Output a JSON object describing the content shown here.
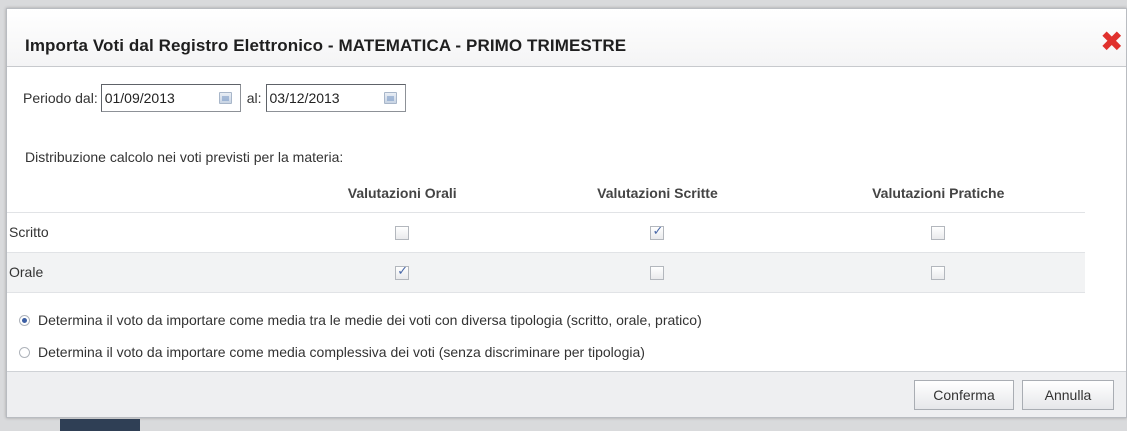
{
  "dialog": {
    "title": "Importa Voti dal Registro Elettronico - MATEMATICA - PRIMO TRIMESTRE"
  },
  "period": {
    "label_from": "Periodo dal:",
    "from_value": "01/09/2013",
    "label_to": "al:",
    "to_value": "03/12/2013"
  },
  "distribution": {
    "label": "Distribuzione calcolo nei voti previsti per la materia:",
    "columns": [
      "Valutazioni Orali",
      "Valutazioni Scritte",
      "Valutazioni Pratiche"
    ],
    "rows": [
      {
        "label": "Scritto",
        "checked": [
          false,
          true,
          false
        ]
      },
      {
        "label": "Orale",
        "checked": [
          true,
          false,
          false
        ]
      }
    ]
  },
  "options": {
    "selected_index": 0,
    "items": [
      "Determina il voto da importare come media tra le medie dei voti con diversa tipologia (scritto, orale, pratico)",
      "Determina il voto da importare come media complessiva dei voti (senza discriminare per tipologia)"
    ]
  },
  "buttons": {
    "confirm": "Conferma",
    "cancel": "Annulla"
  },
  "icons": {
    "close": "close-icon",
    "calendar": "calendar-icon"
  },
  "colors": {
    "close_red": "#e0312d",
    "accent_blue": "#3c5fa4"
  }
}
